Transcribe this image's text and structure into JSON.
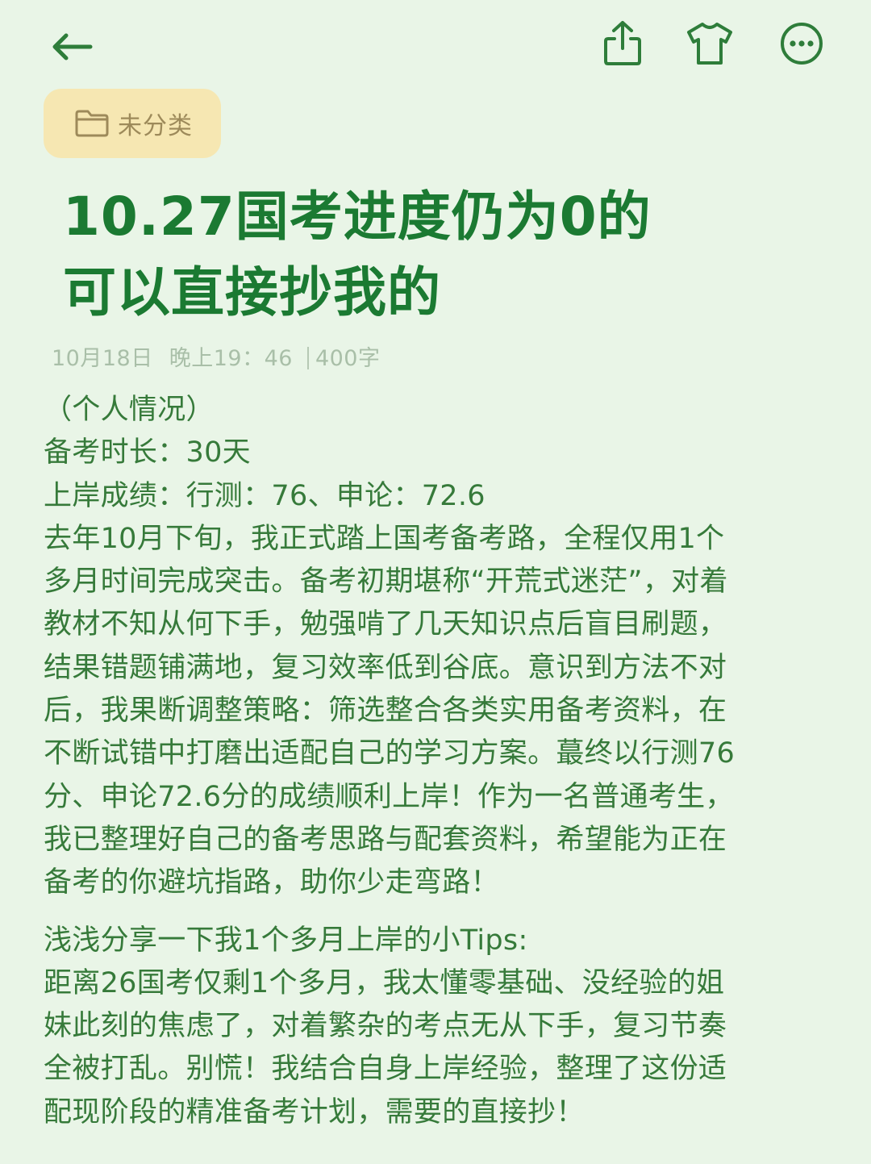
{
  "category": {
    "label": "未分类"
  },
  "title": {
    "line1": "10.27国考进度仍为0的",
    "line2": "可以直接抄我的"
  },
  "meta": {
    "date": "10月18日",
    "time": "晚上19：46",
    "word_count": "400字"
  },
  "content": {
    "lines1": [
      "（个人情况）",
      "备考时长：30天",
      "上岸成绩：行测：76、申论：72.6",
      "去年10月下旬，我正式踏上国考备考路，全程仅用1个",
      "多月时间完成突击。备考初期堪称“开荒式迷茫”，对着",
      "教材不知从何下手，勉强啃了几天知识点后盲目刷题，",
      "结果错题铺满地，复习效率低到谷底。意识到方法不对",
      "后，我果断调整策略：筛选整合各类实用备考资料，在",
      "不断试错中打磨出适配自己的学习方案。蕞终以行测76",
      "分、申论72.6分的成绩顺利上岸！作为一名普通考生，",
      "我已整理好自己的备考思路与配套资料，希望能为正在",
      "备考的你避坑指路，助你少走弯路！"
    ],
    "lines2": [
      "浅浅分享一下我1个多月上岸的小Tips:",
      "距离26国考仅剩1个多月，我太懂零基础、没经验的姐",
      "妹此刻的焦虑了，对着繁杂的考点无从下手，复习节奏",
      "全被打乱。别慌！我结合自身上岸经验，整理了这份适",
      "配现阶段的精准备考计划，需要的直接抄！"
    ]
  },
  "colors": {
    "background": "#e9f5e7",
    "accent": "#1b7a32",
    "body_text": "#367a3a",
    "meta_text": "#a9bfa8",
    "chip_bg": "#f6e7b2",
    "chip_text": "#9d8a5a"
  },
  "icons": {
    "back": "arrow-left-icon",
    "share": "share-icon",
    "theme": "tshirt-icon",
    "more": "more-dots-icon",
    "category": "folder-icon"
  }
}
